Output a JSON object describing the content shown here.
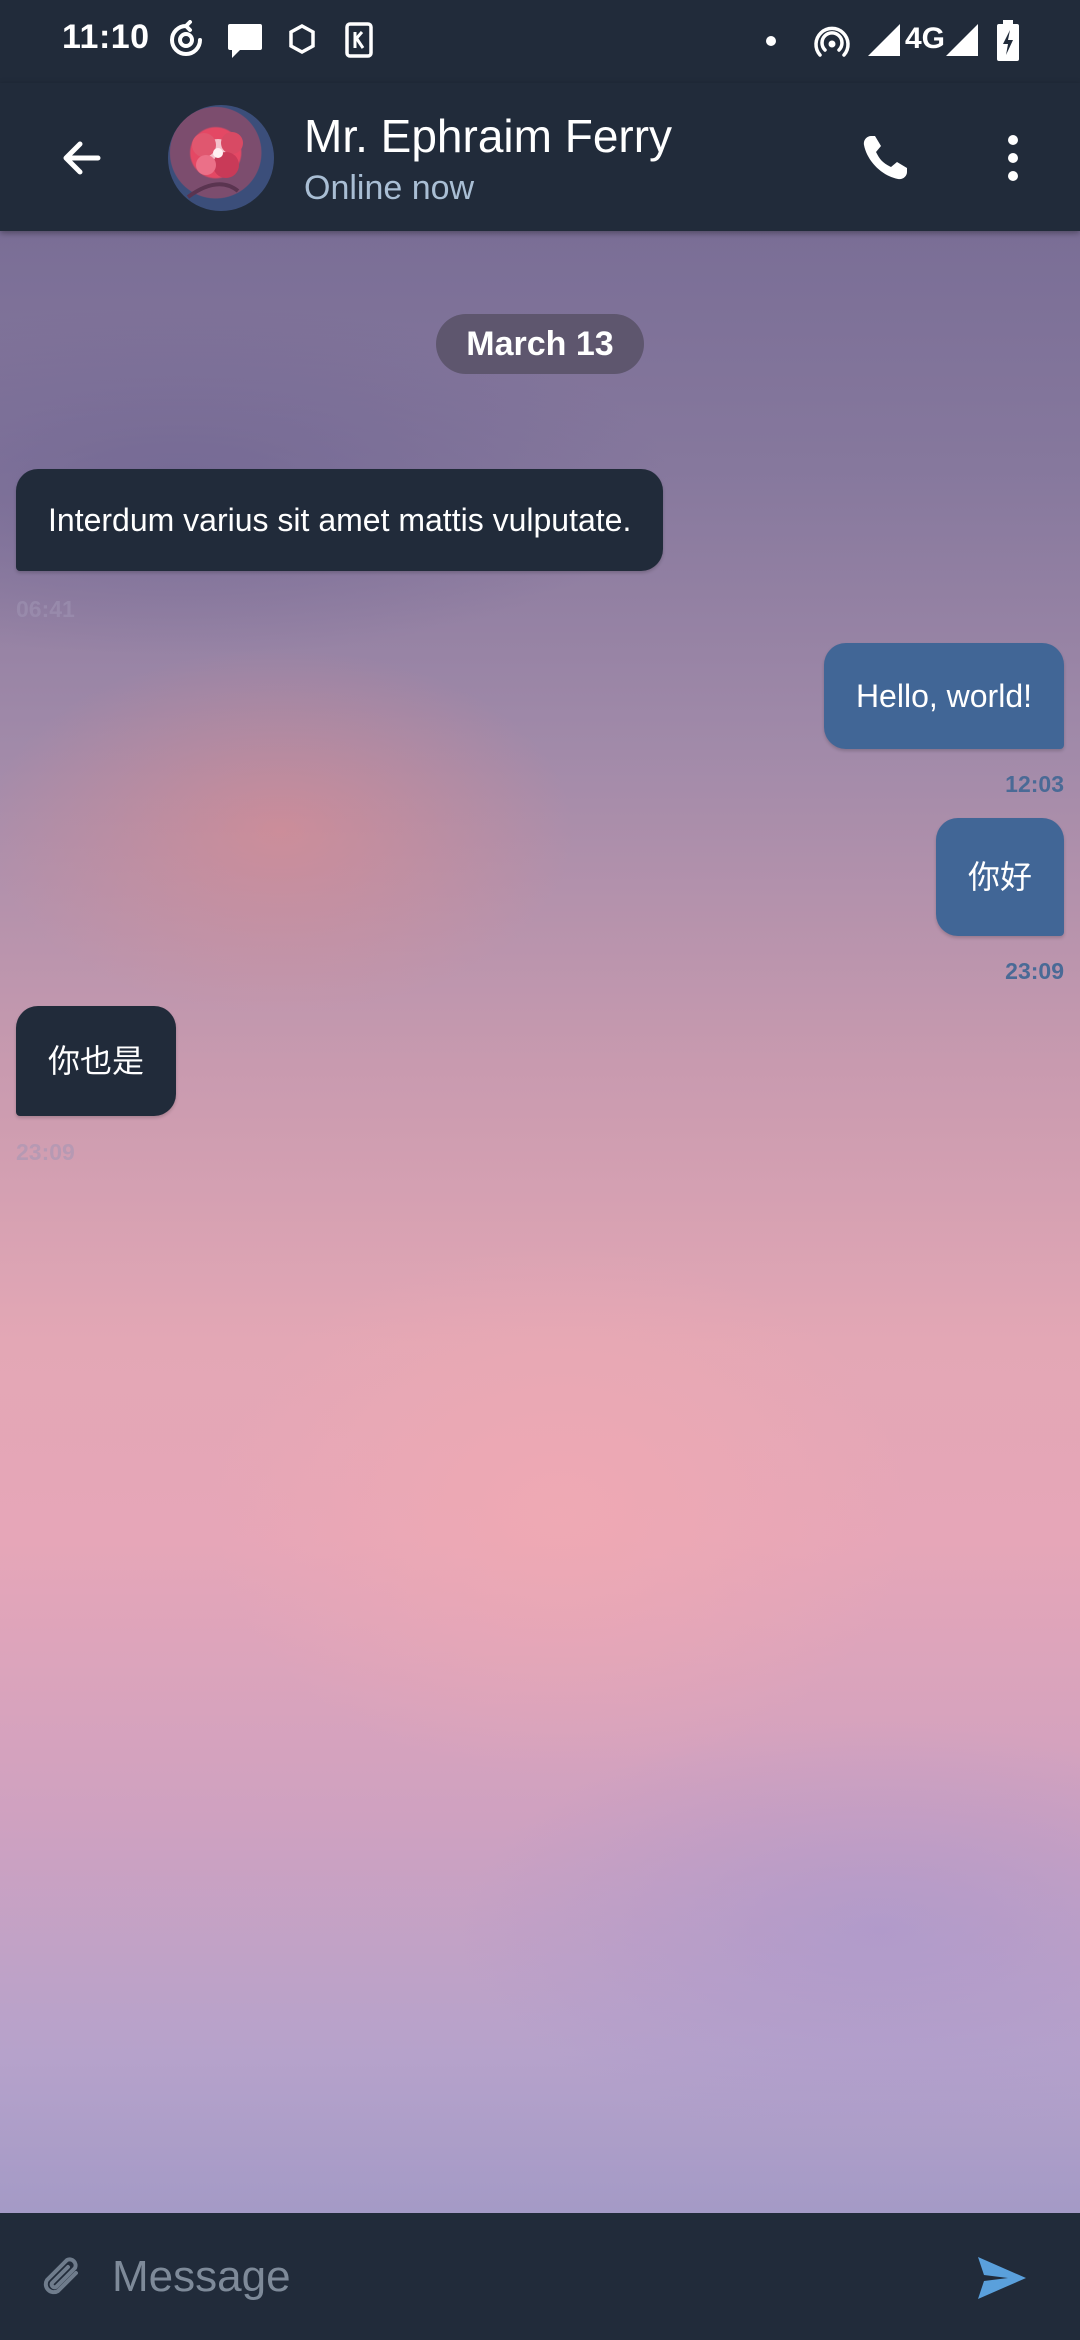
{
  "status_bar": {
    "time": "11:10",
    "network": "4G",
    "icons": [
      "sync-icon",
      "message-notification-icon",
      "hexagon-app-icon",
      "k-app-icon",
      "dot-icon",
      "hotspot-icon",
      "signal-icon",
      "signal-icon",
      "battery-charging-icon"
    ]
  },
  "header": {
    "back_icon": "arrow-left-icon",
    "contact_name": "Mr. Ephraim Ferry",
    "contact_status": "Online now",
    "call_icon": "phone-icon",
    "menu_icon": "more-vertical-icon"
  },
  "chat": {
    "date_label": "March 13",
    "messages": [
      {
        "direction": "in",
        "text": "Interdum varius sit amet mattis vulputate.",
        "time": "06:41"
      },
      {
        "direction": "out",
        "text": "Hello, world!",
        "time": "12:03"
      },
      {
        "direction": "out",
        "text": "你好",
        "time": "23:09"
      },
      {
        "direction": "in",
        "text": "你也是",
        "time": "23:09"
      }
    ]
  },
  "composer": {
    "placeholder": "Message",
    "value": "",
    "attach_icon": "paperclip-icon",
    "send_icon": "send-icon"
  },
  "colors": {
    "bar_background": "#212b3a",
    "incoming_bubble": "#212b3a",
    "outgoing_bubble": "#416696",
    "status_text": "#a9bed4",
    "send_accent": "#5aa0dc"
  }
}
